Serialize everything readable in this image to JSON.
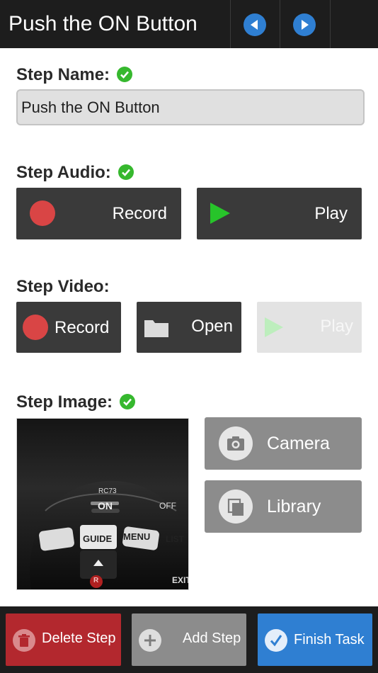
{
  "header": {
    "title": "Push the ON Button",
    "prev_icon": "arrow-left-circle-icon",
    "next_icon": "arrow-right-circle-icon",
    "accent": "#2f7fd2"
  },
  "step_name": {
    "label": "Step Name:",
    "value": "Push the ON Button",
    "complete": true
  },
  "step_audio": {
    "label": "Step Audio:",
    "complete": true,
    "record_label": "Record",
    "play_label": "Play"
  },
  "step_video": {
    "label": "Step Video:",
    "record_label": "Record",
    "open_label": "Open",
    "play_label": "Play",
    "play_enabled": false
  },
  "step_image": {
    "label": "Step Image:",
    "complete": true,
    "image_description_text": {
      "model": "RC73",
      "on": "ON",
      "off": "OFF",
      "guide": "GUIDE",
      "menu": "MENU",
      "list": "LIST",
      "r": "R",
      "exit": "EXIT"
    },
    "camera_label": "Camera",
    "library_label": "Library"
  },
  "bottom_bar": {
    "delete_label": "Delete Step",
    "add_label": "Add Step",
    "finish_label": "Finish Task",
    "delete_color": "#b3282e",
    "add_color": "#8c8c8c",
    "finish_color": "#2f7fd2"
  },
  "colors": {
    "check_green": "#36b82e",
    "record_red": "#d94545",
    "play_green": "#27c42a"
  }
}
